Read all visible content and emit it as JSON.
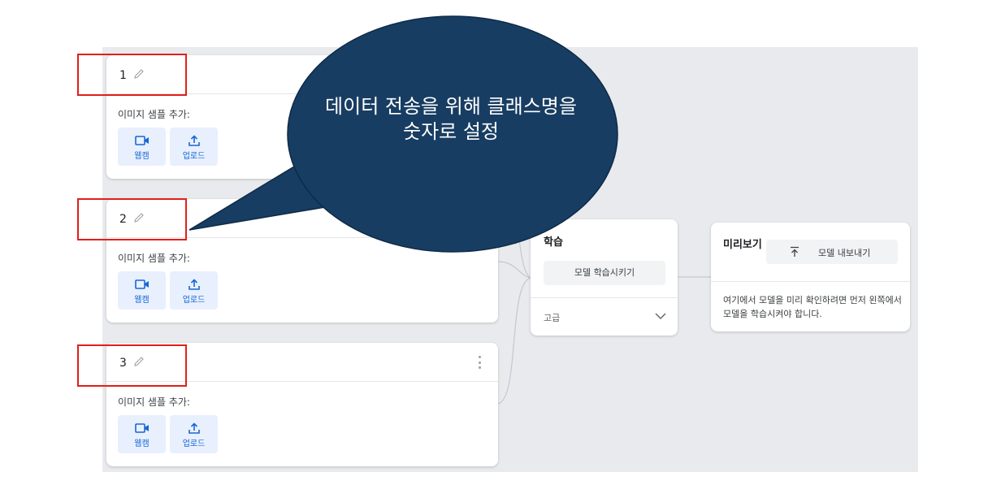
{
  "classes": [
    {
      "title": "1",
      "sample_label": "이미지 샘플 추가:",
      "webcam_label": "웹캠",
      "upload_label": "업로드"
    },
    {
      "title": "2",
      "sample_label": "이미지 샘플 추가:",
      "webcam_label": "웹캠",
      "upload_label": "업로드"
    },
    {
      "title": "3",
      "sample_label": "이미지 샘플 추가:",
      "webcam_label": "웹캠",
      "upload_label": "업로드"
    }
  ],
  "training": {
    "title": "학습",
    "train_button": "모델 학습시키기",
    "advanced_label": "고급"
  },
  "preview": {
    "title": "미리보기",
    "export_button": "모델 내보내기",
    "message": "여기에서 모델을 미리 확인하려면 먼저 왼쪽에서 모델을 학습시켜야 합니다."
  },
  "annotation": {
    "callout_text": "데이터 전송을 위해 클래스명을 숫자로 설정",
    "callout_color": "#183d62",
    "highlight_color": "#e0201a"
  },
  "icons": [
    "pencil-icon",
    "kebab-menu-icon",
    "webcam-icon",
    "upload-icon",
    "chevron-down-icon",
    "upload-arrow-icon"
  ]
}
